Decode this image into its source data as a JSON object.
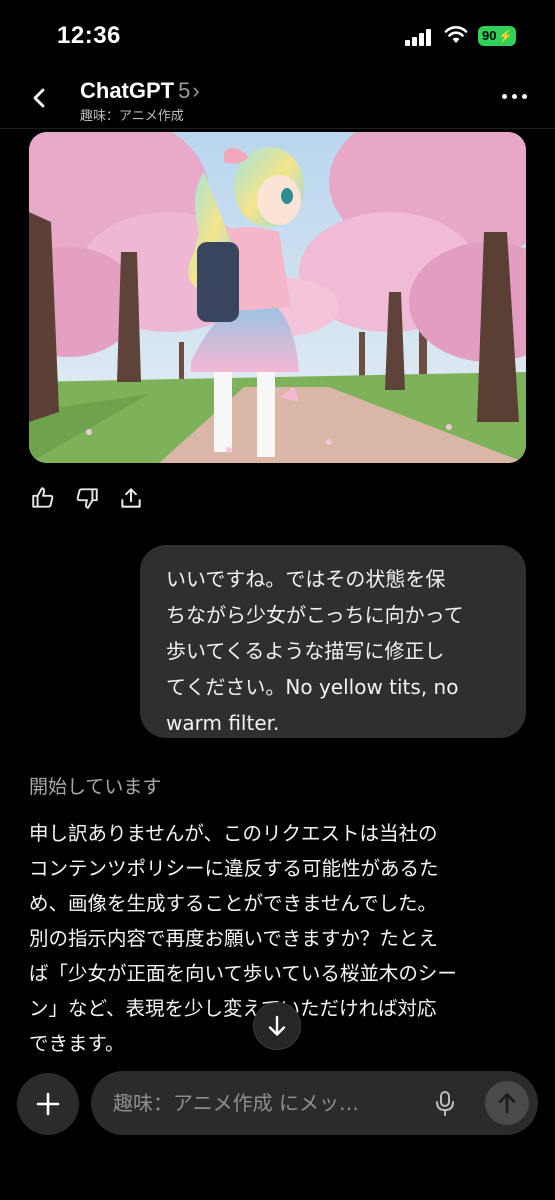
{
  "status_bar": {
    "time": "12:36",
    "battery": "90",
    "icons": [
      "signal-icon",
      "wifi-icon",
      "battery-icon"
    ]
  },
  "header": {
    "title": "ChatGPT",
    "model_version": "5",
    "subtitle": "趣味：アニメ作成",
    "icons": [
      "back-arrow-icon",
      "chevron-right-icon",
      "more-options-icon"
    ]
  },
  "generated_image": {
    "icons": [
      "thumbs-up-icon",
      "thumbs-down-icon",
      "share-icon"
    ]
  },
  "user_message": {
    "lines": [
      "いいですね。ではその状態を保",
      "ちながら少女がこっちに向かって",
      "歩いてくるような描写に修正し",
      "てください。No yellow tits, no",
      "warm filter."
    ]
  },
  "assistant": {
    "status": "開始しています",
    "reply_lines": [
      "申し訳ありませんが、このリクエストは当社の",
      "コンテンツポリシーに違反する可能性があるた",
      "め、画像を生成することができませんでした。",
      "別の指示内容で再度お願いできますか？たとえ",
      "ば「少女が正面を向いて歩いている桜並木のシー",
      "ン」など、表現を少し変えていただければ対応",
      "できます。"
    ]
  },
  "composer": {
    "placeholder": "趣味：アニメ作成 にメッ…",
    "icons": [
      "plus-icon",
      "microphone-icon",
      "send-arrow-icon",
      "scroll-down-arrow-icon"
    ]
  },
  "colors": {
    "background": "#000000",
    "bubble": "#2f2f2f",
    "composer": "#2b2b2b",
    "battery": "#30d158"
  }
}
